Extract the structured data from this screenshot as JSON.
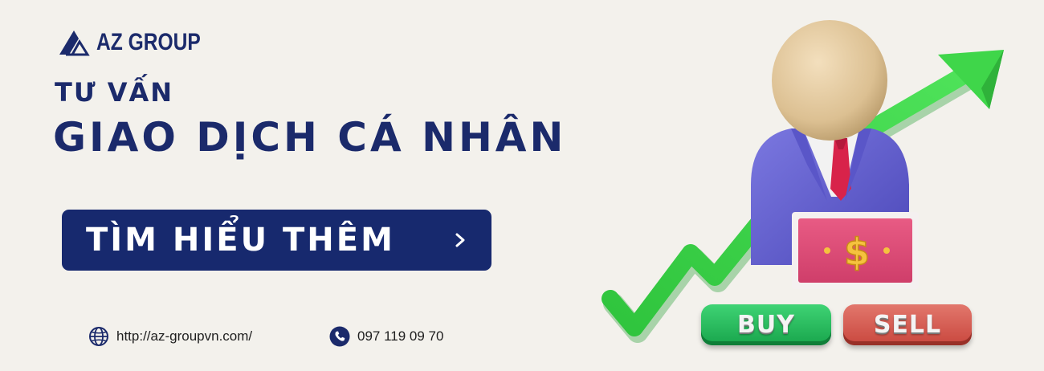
{
  "brand": {
    "name": "AZ GROUP",
    "navy": "#1b2a6b",
    "button_bg": "#17296e"
  },
  "headline": {
    "subtitle": "TƯ VẤN",
    "title": "GIAO DỊCH CÁ NHÂN"
  },
  "cta": {
    "label": "TÌM HIỂU THÊM",
    "icon": "chevron-right-icon"
  },
  "contact": {
    "website": {
      "icon": "globe-icon",
      "text": "http://az-groupvn.com/"
    },
    "phone": {
      "icon": "phone-icon",
      "text": "097 119 09 70"
    }
  },
  "illustration": {
    "buy_label": "BUY",
    "sell_label": "SELL",
    "currency_symbol": "$",
    "arrow_color": "#45d84f",
    "buy_color": "#22b559",
    "sell_color": "#d65a50"
  }
}
